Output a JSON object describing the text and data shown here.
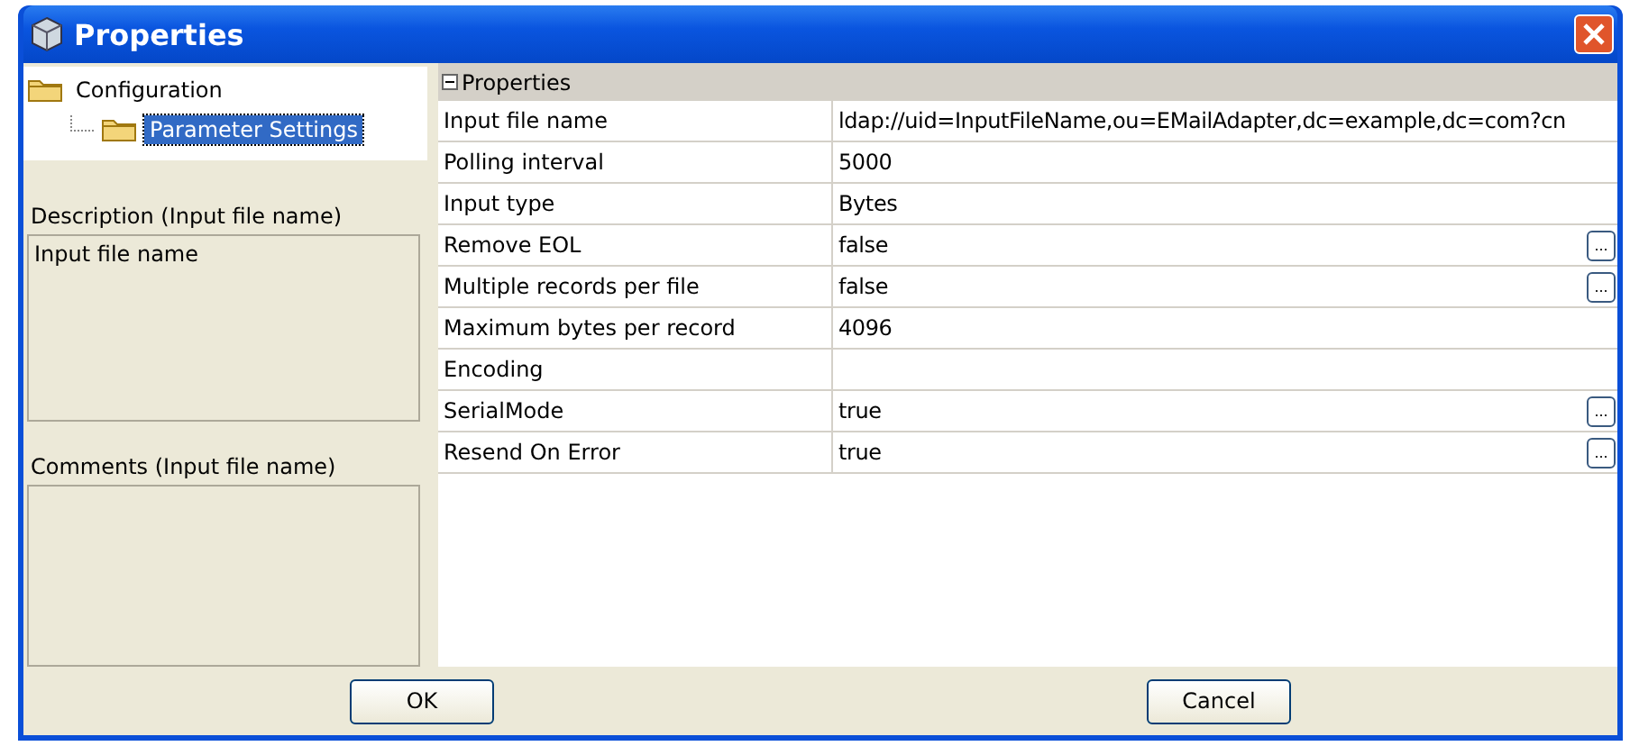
{
  "window": {
    "title": "Properties"
  },
  "tree": [
    {
      "label": "Configuration",
      "selected": false,
      "children": [
        {
          "label": "Parameter Settings",
          "selected": true
        }
      ]
    }
  ],
  "description": {
    "label": "Description (Input file name)",
    "text": "Input file name"
  },
  "comments": {
    "label": "Comments (Input file name)"
  },
  "properties": {
    "group": "Properties",
    "expanded": true,
    "rows": [
      {
        "name": "Input file name",
        "value": "ldap://uid=InputFileName,ou=EMailAdapter,dc=example,dc=com?cn"
      },
      {
        "name": "Polling interval",
        "value": "5000"
      },
      {
        "name": "Input type",
        "value": "Bytes"
      },
      {
        "name": "Remove EOL",
        "value": "false",
        "editor": "..."
      },
      {
        "name": "Multiple records per file",
        "value": "false",
        "editor": "..."
      },
      {
        "name": "Maximum bytes per record",
        "value": "4096"
      },
      {
        "name": "Encoding"
      },
      {
        "name": "SerialMode",
        "value": "true",
        "editor": "..."
      },
      {
        "name": "Resend On Error",
        "value": "true",
        "editor": "..."
      }
    ]
  },
  "buttons": [
    "OK",
    "Cancel"
  ]
}
